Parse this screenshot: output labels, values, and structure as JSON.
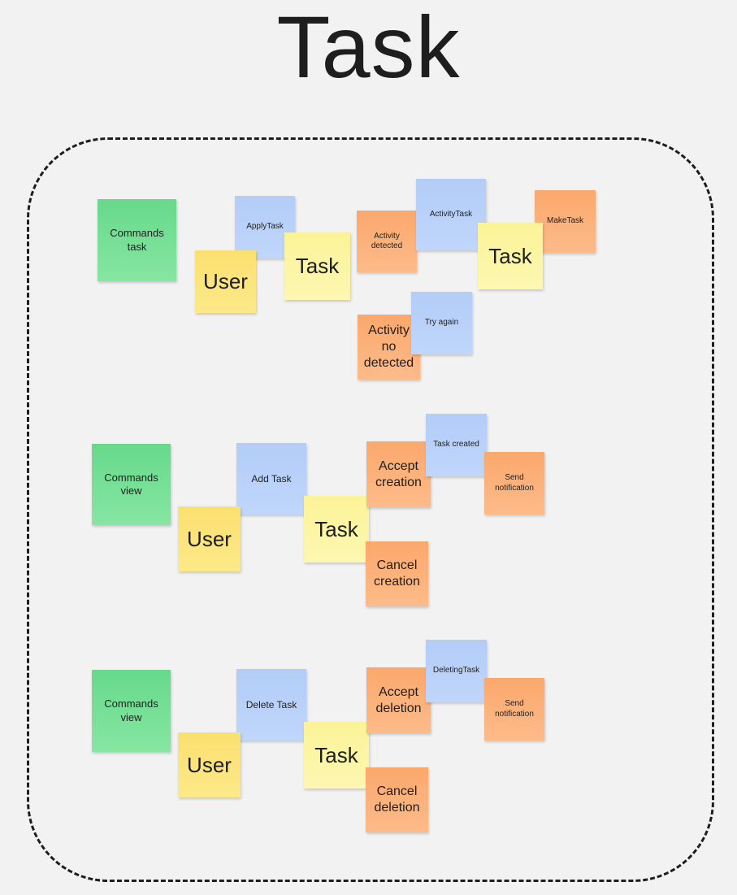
{
  "title": "Task",
  "rows": [
    {
      "command": "Commands\ntask",
      "user": "User",
      "action": "ApplyTask",
      "task": "Task",
      "event_a": "Activity\ndetected",
      "event_b": "Activity\nno\ndetected",
      "cmd_a": "ActivityTask",
      "cmd_b": "Try again",
      "task2": "Task",
      "result": "MakeTask"
    },
    {
      "command": "Commands\nview",
      "user": "User",
      "action": "Add Task",
      "task": "Task",
      "accept": "Accept\ncreation",
      "cancel": "Cancel\ncreation",
      "result": "Task created",
      "notify": "Send\nnotification"
    },
    {
      "command": "Commands\nview",
      "user": "User",
      "action": "Delete Task",
      "task": "Task",
      "accept": "Accept\ndeletion",
      "cancel": "Cancel\ndeletion",
      "result": "DeletingTask",
      "notify": "Send\nnotification"
    }
  ]
}
